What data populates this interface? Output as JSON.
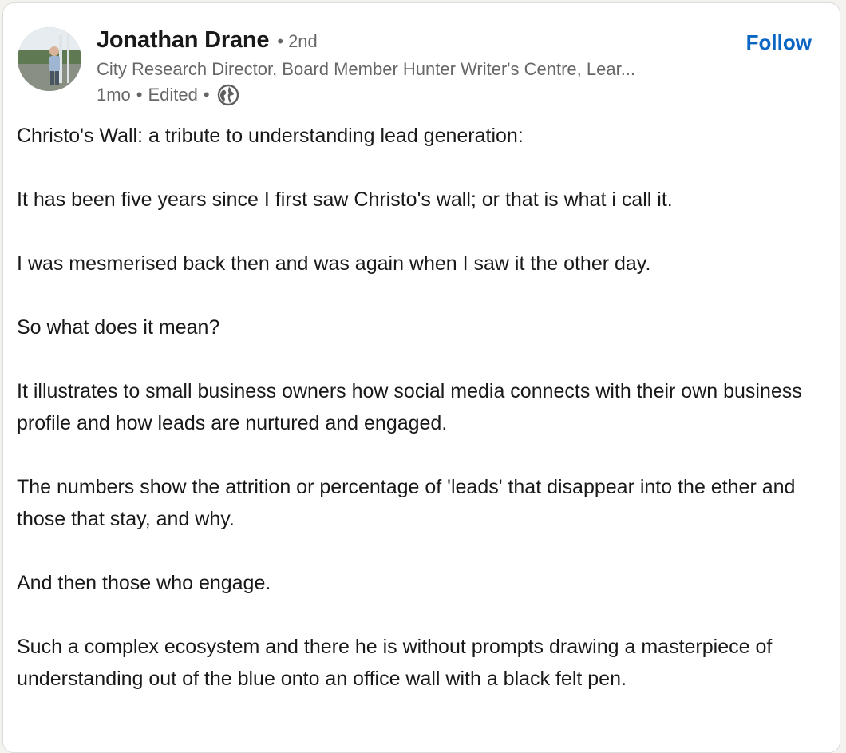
{
  "author": {
    "name": "Jonathan Drane",
    "separator": "•",
    "degree": "2nd",
    "headline": "City Research Director, Board Member Hunter Writer's Centre, Lear...",
    "age": "1mo",
    "edited": "Edited",
    "visibility_icon": "globe-icon"
  },
  "actions": {
    "follow_label": "Follow"
  },
  "post": {
    "paragraphs": [
      "Christo's Wall: a tribute to understanding lead generation:",
      "It has been five years since I first saw Christo's wall; or that is what i call it.",
      "I was mesmerised back then and was again when I saw it the other day.",
      "So what does it mean?",
      "It illustrates to small business owners how social media connects with their own business profile and how leads are nurtured and engaged.",
      "The numbers show the attrition or percentage of 'leads' that disappear into the ether and those that stay, and why.",
      "And then those who engage.",
      "Such a complex ecosystem and there he is without prompts drawing a masterpiece of understanding out of the blue onto an office wall with a black felt pen."
    ]
  },
  "colors": {
    "accent": "#0a66c2",
    "secondary_text": "#666666",
    "primary_text": "#191919"
  }
}
